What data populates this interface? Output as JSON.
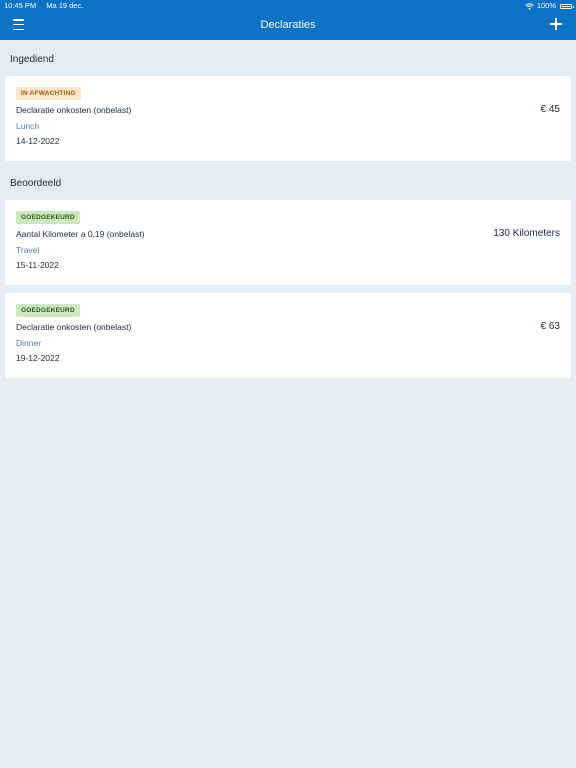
{
  "status_bar": {
    "time": "10:45 PM",
    "date": "Ma 19 dec.",
    "battery": "100%"
  },
  "header": {
    "title": "Declaraties",
    "menu_icon": "hamburger-menu-icon",
    "add_icon": "plus-icon"
  },
  "sections": [
    {
      "title": "Ingediend",
      "items": [
        {
          "status": "IN AFWACHTING",
          "title": "Declaratie onkosten (onbelast)",
          "category": "Lunch",
          "date": "14-12-2022",
          "amount": "€ 45"
        }
      ]
    },
    {
      "title": "Beoordeeld",
      "items": [
        {
          "status": "GOEDGEKEURD",
          "title": "Aantal Kilometer a 0,19 (onbelast)",
          "category": "Travel",
          "date": "15-11-2022",
          "amount": "130 Kilometers"
        },
        {
          "status": "GOEDGEKEURD",
          "title": "Declaratie onkosten (onbelast)",
          "category": "Dinner",
          "date": "19-12-2022",
          "amount": "€ 63"
        }
      ]
    }
  ],
  "colors": {
    "header_bg": "#0b72c4",
    "page_bg": "#e6ecf3",
    "pending_badge_bg": "#fde7cc",
    "pending_badge_text": "#a05a10",
    "approved_badge_bg": "#cde8bd",
    "approved_badge_text": "#2c5a17",
    "category_text": "#4f7aa6"
  }
}
